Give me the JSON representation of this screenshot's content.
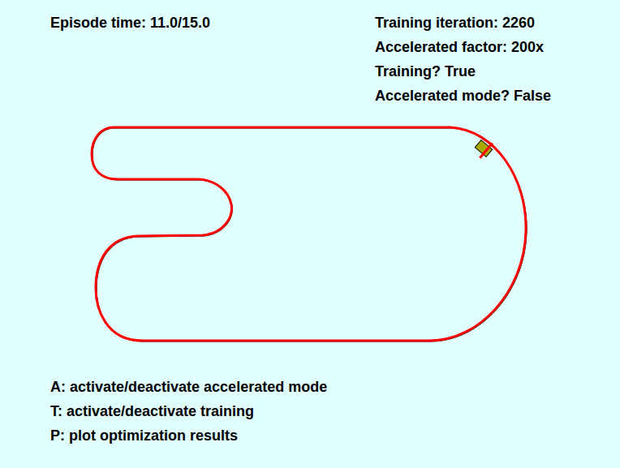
{
  "episode": {
    "text": "Episode time: 11.0/15.0"
  },
  "status_lines": [
    "Training iteration: 2260",
    "Accelerated factor: 200x",
    "Training? True",
    "Accelerated mode? False"
  ],
  "controls": [
    "A: activate/deactivate accelerated mode",
    "T: activate/deactivate training",
    "P: plot optimization results"
  ]
}
